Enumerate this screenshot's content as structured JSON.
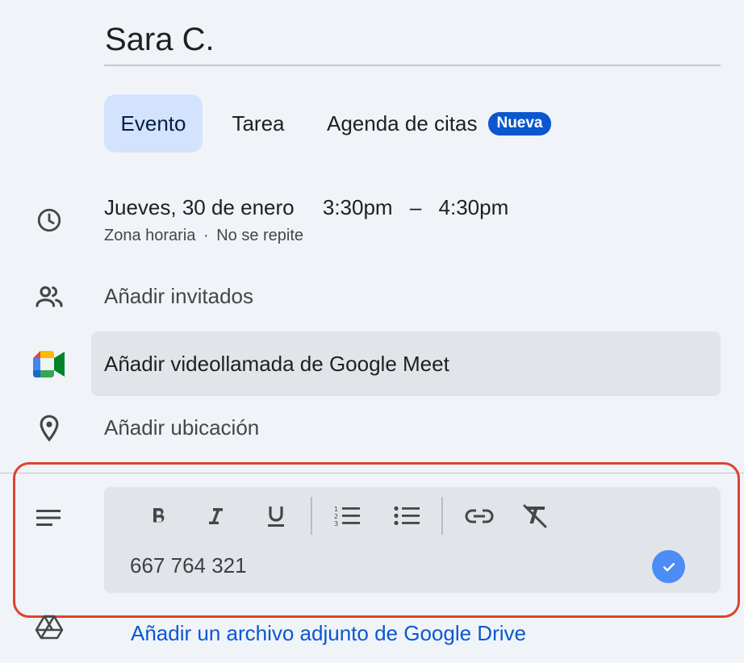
{
  "event": {
    "title": "Sara C."
  },
  "tabs": [
    {
      "label": "Evento",
      "active": true
    },
    {
      "label": "Tarea",
      "active": false
    },
    {
      "label": "Agenda de citas",
      "active": false,
      "badge": "Nueva"
    }
  ],
  "datetime": {
    "date": "Jueves, 30 de enero",
    "start": "3:30pm",
    "dash": "–",
    "end": "4:30pm",
    "timezone": "Zona horaria",
    "separator": "·",
    "repeat": "No se repite",
    "icon": "clock-icon"
  },
  "guests": {
    "label": "Añadir invitados",
    "icon": "people-icon"
  },
  "meet": {
    "label": "Añadir videollamada de Google Meet",
    "icon": "google-meet-icon"
  },
  "location": {
    "label": "Añadir ubicación",
    "icon": "location-pin-icon"
  },
  "description": {
    "icon": "notes-icon",
    "value": "667 764 321",
    "toolbar": [
      "bold-icon",
      "italic-icon",
      "underline-icon",
      "numbered-list-icon",
      "bulleted-list-icon",
      "link-icon",
      "clear-formatting-icon"
    ],
    "confirm_icon": "check-icon"
  },
  "attachment": {
    "label": "Añadir un archivo adjunto de Google Drive",
    "icon": "google-drive-icon"
  },
  "colors": {
    "accent": "#0b57d0",
    "active_tab_bg": "#d3e3fd",
    "highlight_border": "#e0412f",
    "check_bg": "#4c8df5"
  }
}
